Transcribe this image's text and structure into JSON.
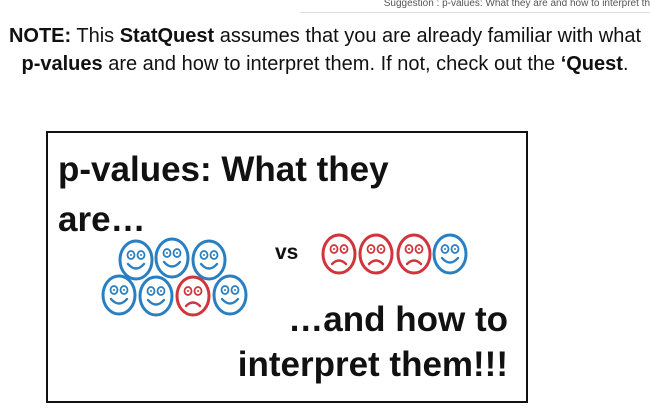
{
  "suggestion_bar": {
    "text": "Suggestion : p-values: What they are and how to interpret th"
  },
  "note": {
    "bold_note": "NOTE:",
    "text_1": " This ",
    "bold_statquest": "StatQuest",
    "text_2": " assumes that you are already familiar with what ",
    "bold_pvalues": "p-values",
    "text_3": " are and how to interpret them. If not, check out the ",
    "bold_quest": "‘Quest",
    "text_4": "."
  },
  "card": {
    "title": "p-values: What they are…",
    "vs_label": "vs",
    "subtitle_line1": "…and how to",
    "subtitle_line2": "interpret them!!!"
  },
  "colors": {
    "happy_face": "#2a7fc1",
    "sad_face": "#d1353b"
  },
  "faces": {
    "left_group": [
      "happy-face",
      "happy-face",
      "happy-face",
      "happy-face",
      "happy-face",
      "sad-face",
      "happy-face"
    ],
    "right_group": [
      "sad-face",
      "sad-face",
      "sad-face",
      "happy-face"
    ]
  }
}
